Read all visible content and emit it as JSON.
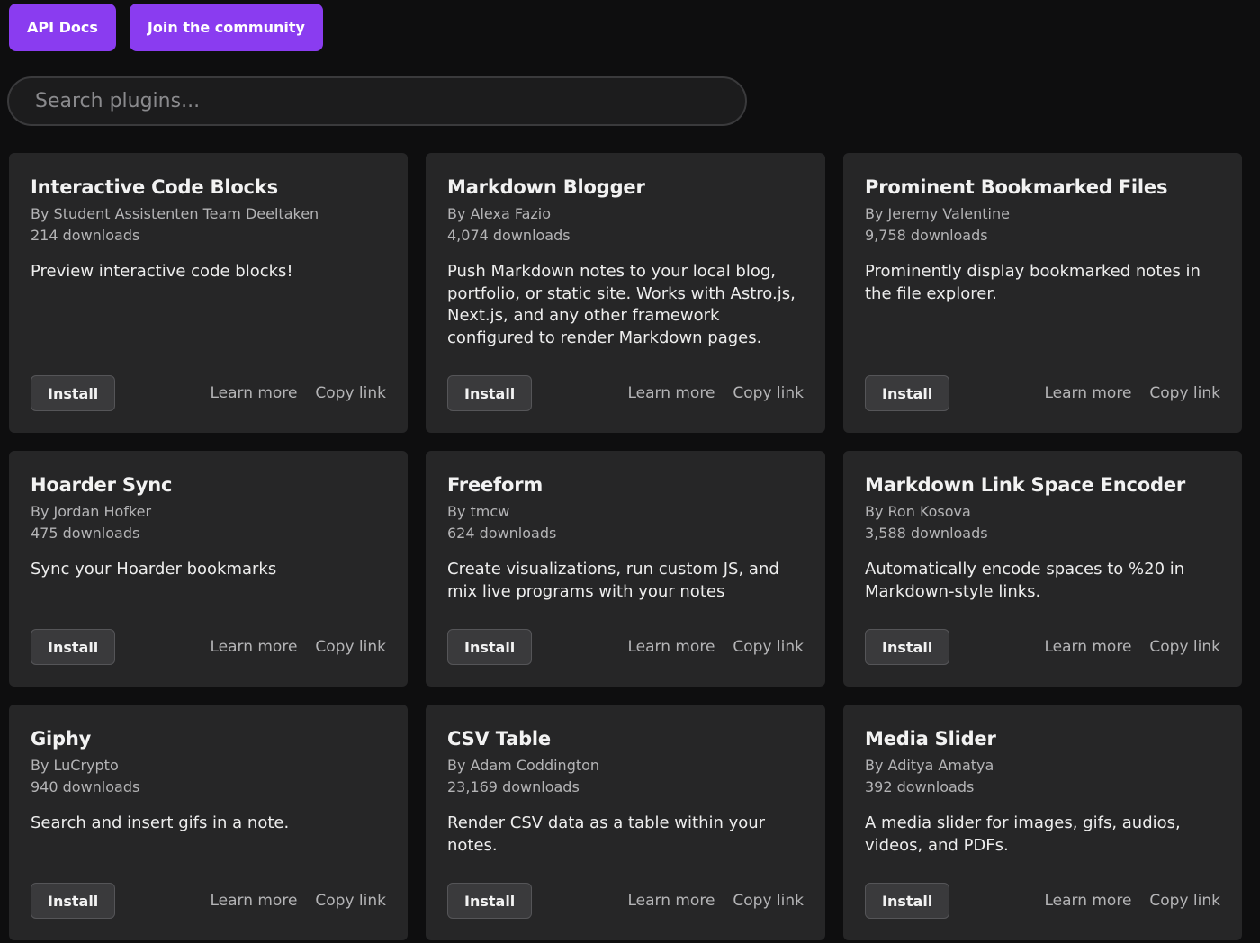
{
  "header": {
    "api_docs_label": "API Docs",
    "community_label": "Join the community"
  },
  "search": {
    "placeholder": "Search plugins...",
    "value": ""
  },
  "colors": {
    "accent": "#8a3cf0",
    "background": "#0e0e0f",
    "card": "#262627"
  },
  "plugins": [
    {
      "title": "Interactive Code Blocks",
      "author": "By Student Assistenten Team Deeltaken",
      "downloads": "214 downloads",
      "description": "Preview interactive code blocks!",
      "install_label": "Install",
      "learn_more_label": "Learn more",
      "copy_link_label": "Copy link"
    },
    {
      "title": "Markdown Blogger",
      "author": "By Alexa Fazio",
      "downloads": "4,074 downloads",
      "description": "Push Markdown notes to your local blog, portfolio, or static site. Works with Astro.js, Next.js, and any other framework configured to render Markdown pages.",
      "install_label": "Install",
      "learn_more_label": "Learn more",
      "copy_link_label": "Copy link"
    },
    {
      "title": "Prominent Bookmarked Files",
      "author": "By Jeremy Valentine",
      "downloads": "9,758 downloads",
      "description": "Prominently display bookmarked notes in the file explorer.",
      "install_label": "Install",
      "learn_more_label": "Learn more",
      "copy_link_label": "Copy link"
    },
    {
      "title": "Hoarder Sync",
      "author": "By Jordan Hofker",
      "downloads": "475 downloads",
      "description": "Sync your Hoarder bookmarks",
      "install_label": "Install",
      "learn_more_label": "Learn more",
      "copy_link_label": "Copy link"
    },
    {
      "title": "Freeform",
      "author": "By tmcw",
      "downloads": "624 downloads",
      "description": "Create visualizations, run custom JS, and mix live programs with your notes",
      "install_label": "Install",
      "learn_more_label": "Learn more",
      "copy_link_label": "Copy link"
    },
    {
      "title": "Markdown Link Space Encoder",
      "author": "By Ron Kosova",
      "downloads": "3,588 downloads",
      "description": "Automatically encode spaces to %20 in Markdown-style links.",
      "install_label": "Install",
      "learn_more_label": "Learn more",
      "copy_link_label": "Copy link"
    },
    {
      "title": "Giphy",
      "author": "By LuCrypto",
      "downloads": "940 downloads",
      "description": "Search and insert gifs in a note.",
      "install_label": "Install",
      "learn_more_label": "Learn more",
      "copy_link_label": "Copy link"
    },
    {
      "title": "CSV Table",
      "author": "By Adam Coddington",
      "downloads": "23,169 downloads",
      "description": "Render CSV data as a table within your notes.",
      "install_label": "Install",
      "learn_more_label": "Learn more",
      "copy_link_label": "Copy link"
    },
    {
      "title": "Media Slider",
      "author": "By Aditya Amatya",
      "downloads": "392 downloads",
      "description": "A media slider for images, gifs, audios, videos, and PDFs.",
      "install_label": "Install",
      "learn_more_label": "Learn more",
      "copy_link_label": "Copy link"
    }
  ]
}
